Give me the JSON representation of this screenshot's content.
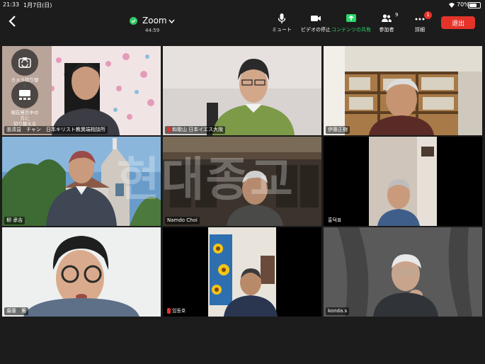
{
  "status": {
    "time": "21:33",
    "date": "1月7日(日)",
    "battery": "70%",
    "battery_level": 0.7
  },
  "meeting": {
    "app": "Zoom",
    "elapsed": "44:59"
  },
  "toolbar": {
    "mute": "ミュート",
    "video_stop": "ビデオの停止",
    "share": "コンテンツの共有",
    "participants": "参加者",
    "participants_count": "9",
    "more": "詳細",
    "more_badge": "1",
    "leave": "退出"
  },
  "self_controls": {
    "switch_camera": "カメラ切り替え",
    "current_speaker_line1": "現在発言中の",
    "current_speaker_line2": "方に",
    "current_speaker_line3": "切り替える"
  },
  "tiles": [
    {
      "name": "張清益　チャン　日本キリスト教異端相談所",
      "active": true
    },
    {
      "name": "和歌山 日本イエス大阪"
    },
    {
      "name": "伊藤正樹"
    },
    {
      "name": "柳 承吉"
    },
    {
      "name": "Namdo Choi"
    },
    {
      "name": "홍덕표"
    },
    {
      "name": "齋藤　篤"
    },
    {
      "name": "임동호"
    },
    {
      "name": "konda.s"
    }
  ],
  "watermark": "현대종교",
  "colors": {
    "leave": "#e5332a",
    "active_border": "#30c864",
    "share_green": "#2bd66a",
    "background": "#1c1c1c"
  }
}
